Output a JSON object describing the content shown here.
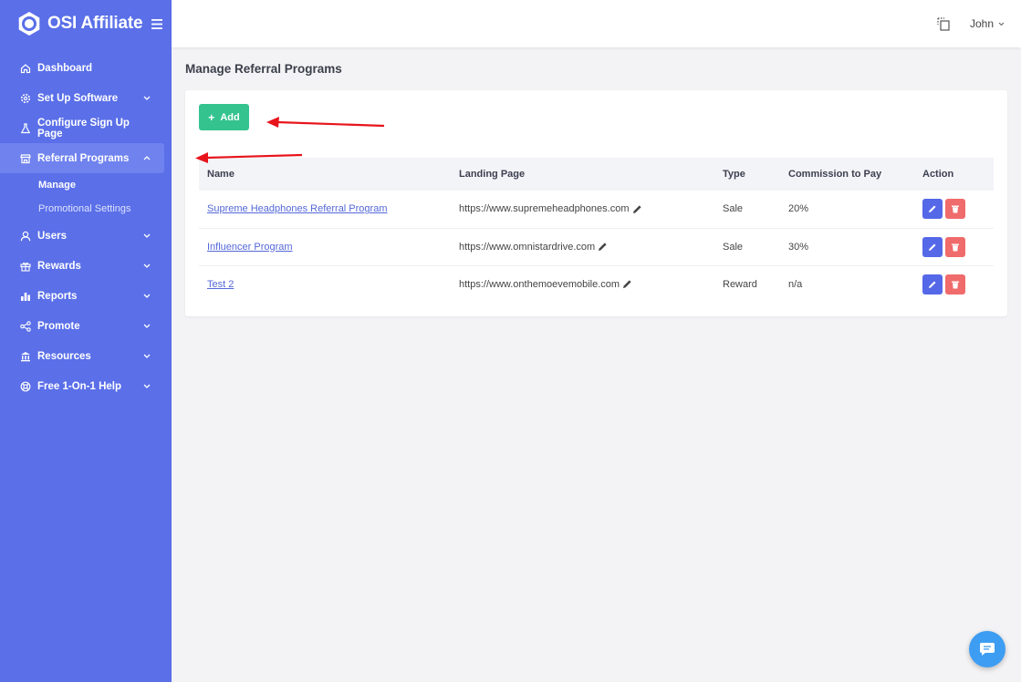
{
  "brand": {
    "name": "OSI Affiliate",
    "menu_icon": "hamburger-icon"
  },
  "sidebar": {
    "items": [
      {
        "label": "Dashboard",
        "icon": "home-icon",
        "caret": false
      },
      {
        "label": "Set Up Software",
        "icon": "gear-icon",
        "caret": "down"
      },
      {
        "label": "Configure Sign Up Page",
        "icon": "flask-icon",
        "caret": false
      },
      {
        "label": "Referral Programs",
        "icon": "store-icon",
        "caret": "up",
        "active": true
      },
      {
        "label": "Users",
        "icon": "user-icon",
        "caret": "down"
      },
      {
        "label": "Rewards",
        "icon": "gift-icon",
        "caret": "down"
      },
      {
        "label": "Reports",
        "icon": "bar-chart-icon",
        "caret": "down"
      },
      {
        "label": "Promote",
        "icon": "share-icon",
        "caret": "down"
      },
      {
        "label": "Resources",
        "icon": "bank-icon",
        "caret": "down"
      },
      {
        "label": "Free 1-On-1 Help",
        "icon": "lifebuoy-icon",
        "caret": "down"
      }
    ],
    "sub_items": [
      {
        "label": "Manage",
        "active": true
      },
      {
        "label": "Promotional Settings",
        "active": false
      }
    ]
  },
  "topbar": {
    "user_name": "John",
    "icon": "copy-icon"
  },
  "page": {
    "title": "Manage Referral Programs"
  },
  "toolbar": {
    "add_label": "Add"
  },
  "table": {
    "headers": [
      "Name",
      "Landing Page",
      "Type",
      "Commission to Pay",
      "Action"
    ],
    "rows": [
      {
        "name": "Supreme Headphones Referral Program",
        "landing": "https://www.supremeheadphones.com",
        "type": "Sale",
        "commission": "20%"
      },
      {
        "name": "Influencer Program",
        "landing": "https://www.omnistardrive.com",
        "type": "Sale",
        "commission": "30%"
      },
      {
        "name": "Test 2",
        "landing": "https://www.onthemoevemobile.com",
        "type": "Reward",
        "commission": "n/a"
      }
    ]
  },
  "colors": {
    "sidebar": "#5a6fe8",
    "add_button": "#34c38f",
    "edit_button": "#5468e8",
    "delete_button": "#f06b6b",
    "annotation_arrow": "#e8141c",
    "chat_button": "#3d9df2"
  }
}
